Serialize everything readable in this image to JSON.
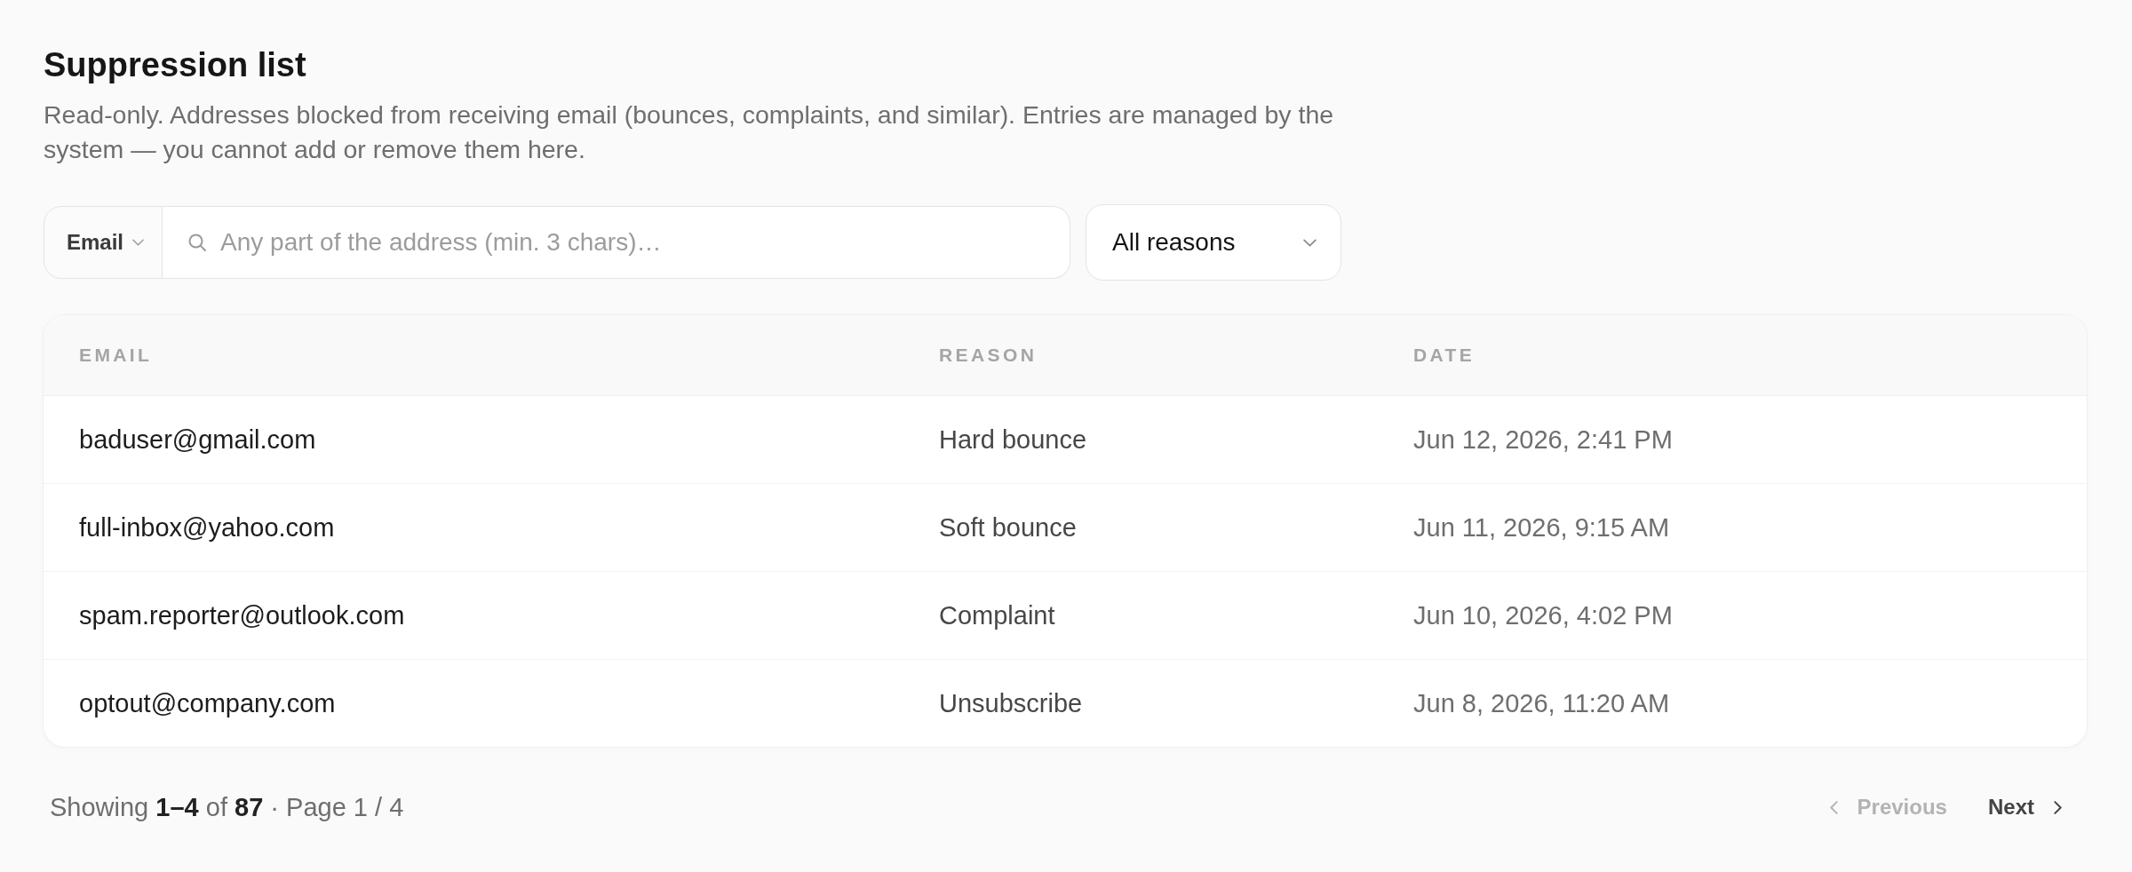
{
  "header": {
    "title": "Suppression list",
    "description": "Read-only. Addresses blocked from receiving email (bounces, complaints, and similar). Entries are managed by the system — you cannot add or remove them here."
  },
  "filters": {
    "field_select": {
      "value": "Email"
    },
    "search": {
      "placeholder": "Any part of the address (min. 3 chars)…"
    },
    "reason_select": {
      "value": "All reasons"
    }
  },
  "table": {
    "columns": [
      "EMAIL",
      "REASON",
      "DATE"
    ],
    "rows": [
      {
        "email": "baduser@gmail.com",
        "reason": "Hard bounce",
        "date": "Jun 12, 2026, 2:41 PM"
      },
      {
        "email": "full-inbox@yahoo.com",
        "reason": "Soft bounce",
        "date": "Jun 11, 2026, 9:15 AM"
      },
      {
        "email": "spam.reporter@outlook.com",
        "reason": "Complaint",
        "date": "Jun 10, 2026, 4:02 PM"
      },
      {
        "email": "optout@company.com",
        "reason": "Unsubscribe",
        "date": "Jun 8, 2026, 11:20 AM"
      }
    ]
  },
  "pagination": {
    "summary": "Showing **1–4** of **87** · Page 1 / 4",
    "previous": {
      "label": "Previous",
      "disabled": true
    },
    "next": {
      "label": "Next",
      "disabled": false
    }
  }
}
